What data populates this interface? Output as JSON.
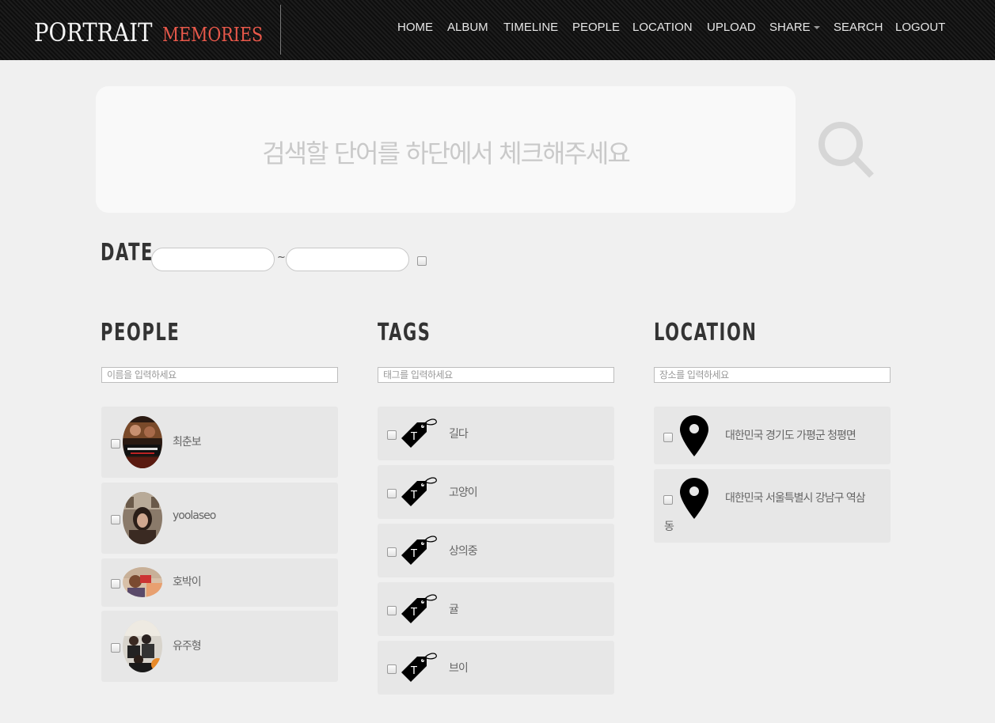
{
  "brand": {
    "main": "PORTRAIT",
    "sub": "MEMORIES",
    "sub_color": "#e8584a"
  },
  "nav": {
    "items": [
      "HOME",
      "ALBUM",
      "TIMELINE",
      "PEOPLE",
      "LOCATION",
      "UPLOAD",
      "SHARE",
      "SEARCH",
      "LOGOUT"
    ]
  },
  "search": {
    "placeholder": "검색할 단어를 하단에서 체크해주세요",
    "icon": "magnifier-icon"
  },
  "date": {
    "title": "DATE",
    "separator": "~",
    "from_value": "",
    "to_value": ""
  },
  "people": {
    "title": "PEOPLE",
    "filter_placeholder": "이름을 입력하세요",
    "items": [
      {
        "name": "최춘보"
      },
      {
        "name": "yoolaseo"
      },
      {
        "name": "호박이"
      },
      {
        "name": "유주형"
      }
    ]
  },
  "tags": {
    "title": "TAGS",
    "filter_placeholder": "태그를 입력하세요",
    "icon_letter": "T",
    "items": [
      {
        "name": "길다"
      },
      {
        "name": "고양이"
      },
      {
        "name": "상의중"
      },
      {
        "name": "귤"
      },
      {
        "name": "브이"
      }
    ]
  },
  "location": {
    "title": "LOCATION",
    "filter_placeholder": "장소를 입력하세요",
    "items": [
      {
        "name": "대한민국 경기도 가평군 청평면"
      },
      {
        "name_line1": "대한민국 서울특별시 강남구 역삼",
        "name_line2": "동"
      }
    ]
  }
}
